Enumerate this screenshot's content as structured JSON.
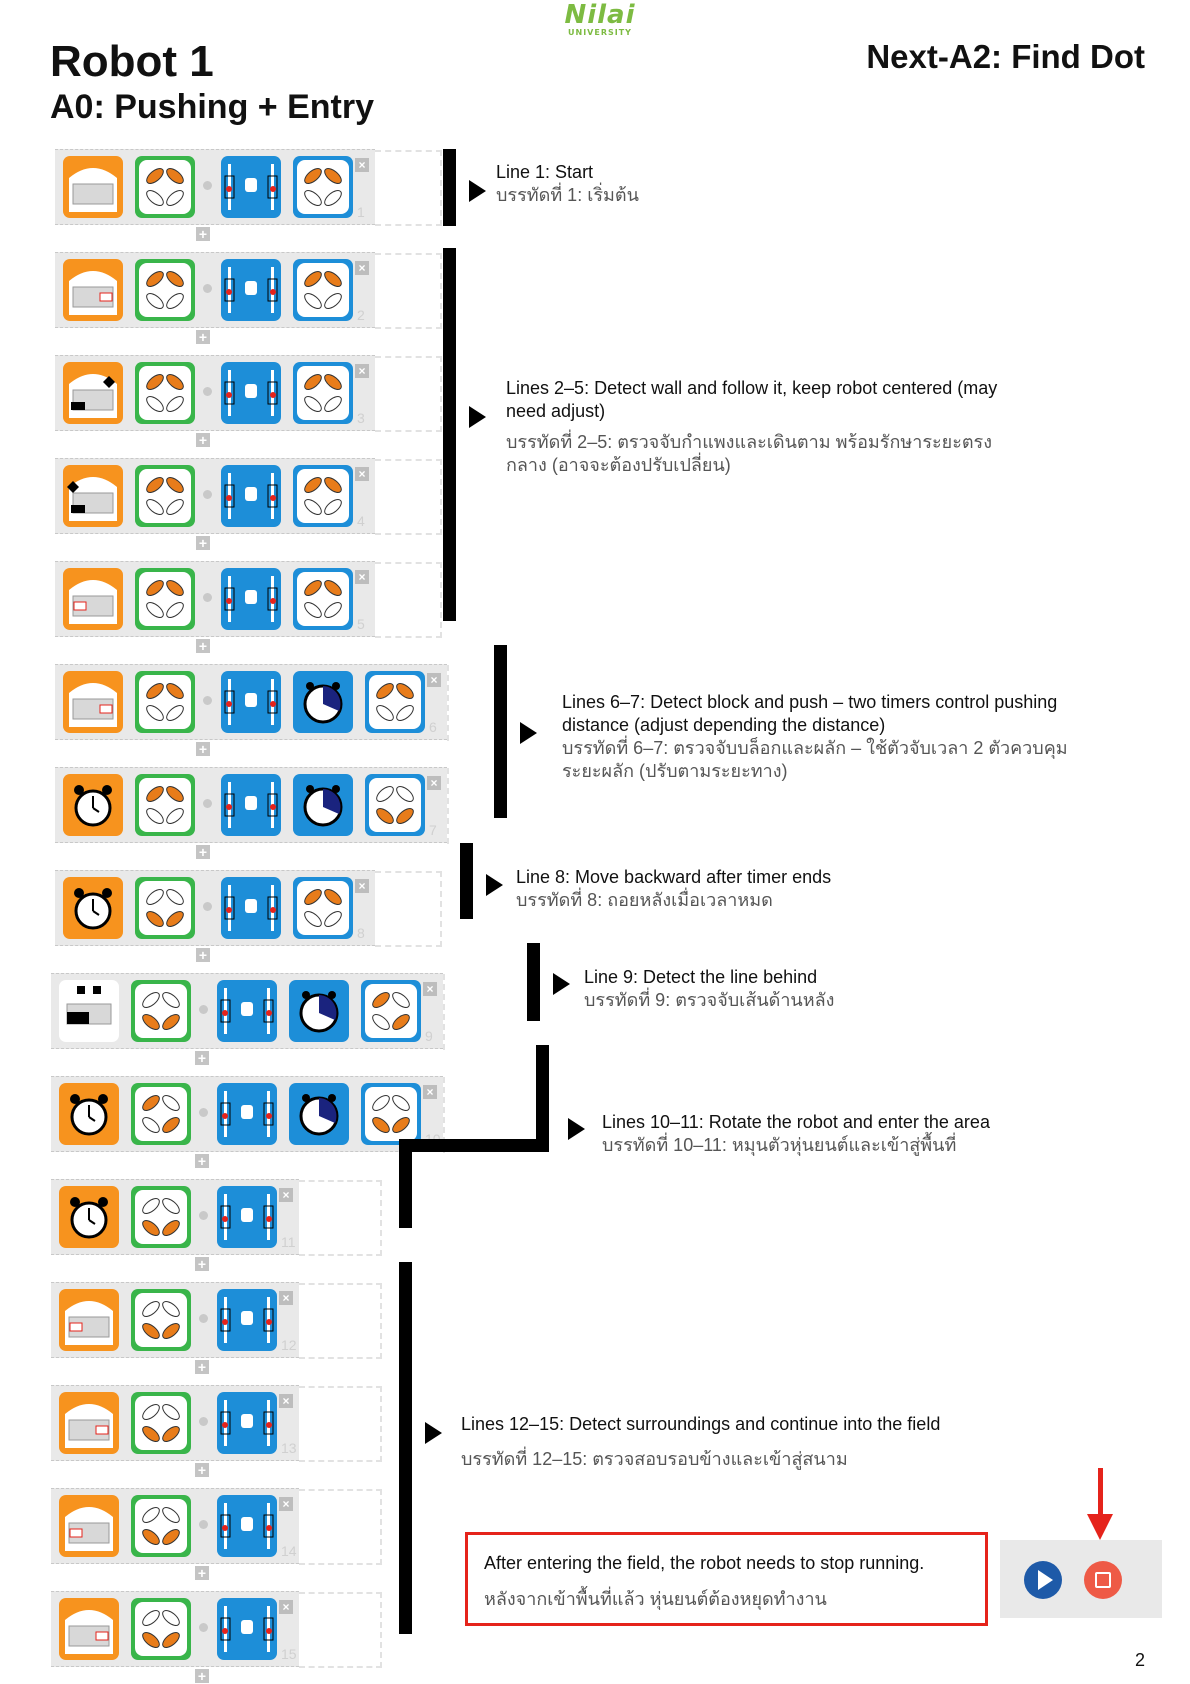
{
  "header": {
    "logo_text": "Nilai",
    "logo_sub": "UNIVERSITY",
    "title": "Robot 1",
    "subtitle": "A0: Pushing + Entry",
    "right_title": "Next-A2: Find Dot"
  },
  "page_number": "2",
  "program_rows": [
    {
      "number": "1",
      "blocks": [
        "sensor-empty",
        "motion-forward",
        "dir-straight",
        "motion-forward-blue"
      ]
    },
    {
      "number": "2",
      "blocks": [
        "sensor-right-front",
        "motion-forward",
        "dir-straight",
        "motion-forward-blue"
      ]
    },
    {
      "number": "3",
      "blocks": [
        "sensor-right-wall",
        "motion-forward",
        "dir-right",
        "motion-forward-blue"
      ]
    },
    {
      "number": "4",
      "blocks": [
        "sensor-left-wall",
        "motion-forward",
        "dir-straight",
        "motion-forward-blue"
      ]
    },
    {
      "number": "5",
      "blocks": [
        "sensor-left-front",
        "motion-forward",
        "dir-left",
        "motion-forward-blue"
      ]
    },
    {
      "number": "6",
      "blocks": [
        "sensor-front",
        "motion-forward",
        "dir-straight",
        "timer",
        "motion-forward-blue"
      ]
    },
    {
      "number": "7",
      "blocks": [
        "alarm",
        "motion-forward",
        "dir-straight",
        "timer",
        "motion-backward-blue"
      ]
    },
    {
      "number": "8",
      "blocks": [
        "alarm",
        "motion-backward",
        "dir-straight",
        "motion-forward-blue"
      ]
    },
    {
      "number": "9",
      "blocks": [
        "sensor-line-behind",
        "motion-backward",
        "dir-straight",
        "timer",
        "motion-turn-blue"
      ]
    },
    {
      "number": "10",
      "blocks": [
        "alarm",
        "motion-turn",
        "dir-rotate",
        "timer",
        "motion-backward-blue"
      ]
    },
    {
      "number": "11",
      "blocks": [
        "alarm",
        "motion-backward",
        "dir-straight"
      ]
    },
    {
      "number": "12",
      "blocks": [
        "sensor-left-front",
        "motion-backward",
        "dir-straight"
      ]
    },
    {
      "number": "13",
      "blocks": [
        "sensor-right-front",
        "motion-backward",
        "dir-straight"
      ]
    },
    {
      "number": "14",
      "blocks": [
        "sensor-left-front",
        "motion-backward",
        "dir-straight"
      ]
    },
    {
      "number": "15",
      "blocks": [
        "sensor-right-front",
        "motion-backward",
        "dir-straight"
      ]
    }
  ],
  "annotations": [
    {
      "en": "Line 1: Start",
      "th": "บรรทัดที่ 1: เริ่มต้น"
    },
    {
      "en": "Lines 2–5: Detect wall and follow it, keep robot centered (may need adjust)",
      "th": "บรรทัดที่ 2–5: ตรวจจับกำแพงและเดินตาม พร้อมรักษาระยะตรงกลาง (อาจจะต้องปรับเปลี่ยน)"
    },
    {
      "en": "Lines 6–7: Detect block and push – two timers control pushing distance (adjust depending the distance)",
      "th": "บรรทัดที่ 6–7: ตรวจจับบล็อกและผลัก – ใช้ตัวจับเวลา 2 ตัวควบคุมระยะผลัก (ปรับตามระยะทาง)"
    },
    {
      "en": "Line 8: Move backward after timer ends",
      "th": "บรรทัดที่ 8: ถอยหลังเมื่อเวลาหมด"
    },
    {
      "en": "Line 9: Detect the line behind",
      "th": "บรรทัดที่ 9: ตรวจจับเส้นด้านหลัง"
    },
    {
      "en": "Lines 10–11: Rotate the robot and enter the area",
      "th": "บรรทัดที่ 10–11: หมุนตัวหุ่นยนต์และเข้าสู่พื้นที่"
    },
    {
      "en": "Lines 12–15: Detect surroundings and continue into the field",
      "th": "บรรทัดที่ 12–15: ตรวจสอบรอบข้างและเข้าสู่สนาม"
    }
  ],
  "note": {
    "en": "After entering the field, the robot needs to stop running.",
    "th": "หลังจากเข้าพื้นที่แล้ว หุ่นยนต์ต้องหยุดทำงาน"
  },
  "controls": {
    "play_icon": "play-icon",
    "stop_icon": "stop-icon"
  },
  "colors": {
    "sensor_orange": "#f7931e",
    "motion_green": "#39b54a",
    "direction_blue": "#1d8ed8",
    "highlight_red": "#e5231b",
    "play_blue": "#1e5aa8",
    "stop_red": "#ee5a46"
  }
}
